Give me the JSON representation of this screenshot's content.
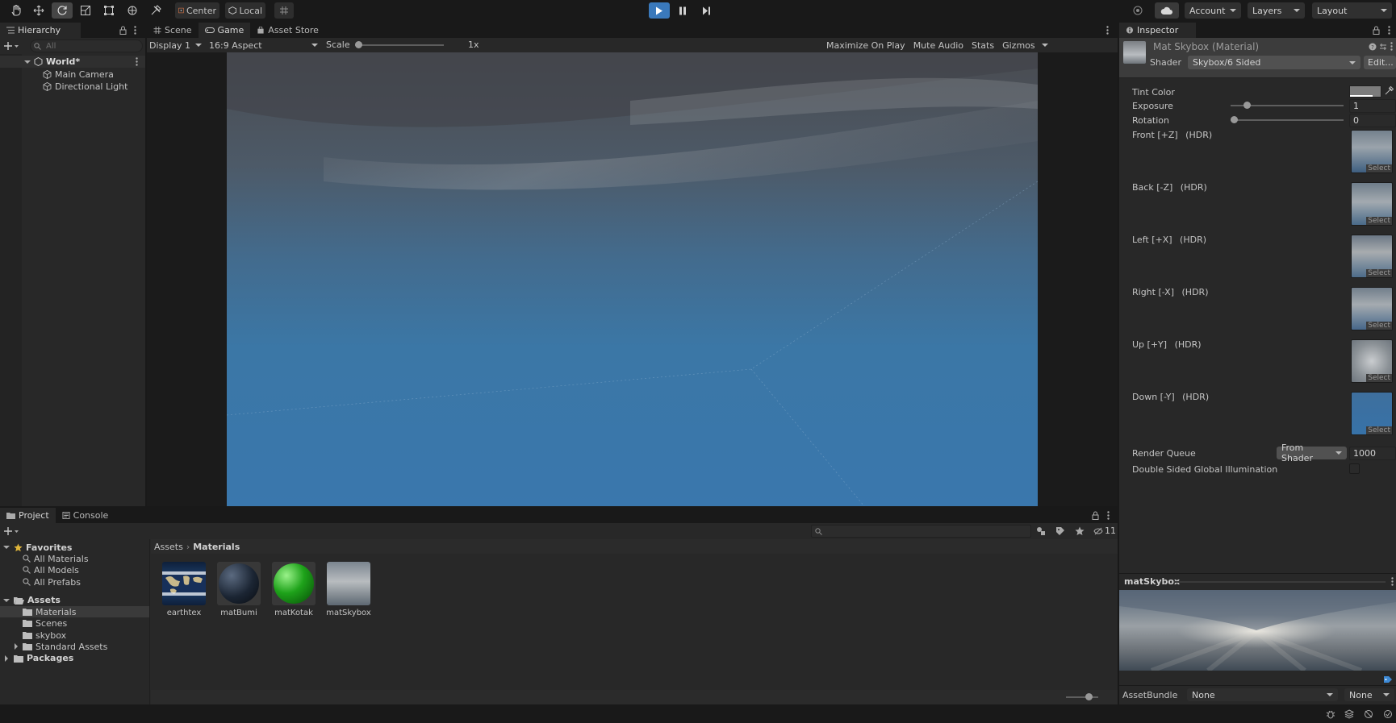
{
  "toolbar": {
    "pivot_label": "Center",
    "space_label": "Local",
    "account_label": "Account",
    "layers_label": "Layers",
    "layout_label": "Layout"
  },
  "hierarchy": {
    "tab_label": "Hierarchy",
    "search_placeholder": "All",
    "items": [
      {
        "label": "World*"
      },
      {
        "label": "Main Camera"
      },
      {
        "label": "Directional Light"
      }
    ]
  },
  "scene_view": {
    "tabs": [
      {
        "label": "Scene"
      },
      {
        "label": "Game"
      },
      {
        "label": "Asset Store"
      }
    ],
    "display_label": "Display 1",
    "aspect_label": "16:9 Aspect",
    "scale_label": "Scale",
    "scale_value": "1x",
    "scale_slider_fraction": 0.0,
    "maximize_label": "Maximize On Play",
    "mute_label": "Mute Audio",
    "stats_label": "Stats",
    "gizmos_label": "Gizmos"
  },
  "inspector": {
    "tab_label": "Inspector",
    "title": "Mat Skybox (Material)",
    "shader_label": "Shader",
    "shader_value": "Skybox/6 Sided",
    "edit_label": "Edit...",
    "tint_label": "Tint Color",
    "exposure_label": "Exposure",
    "exposure_value": "1",
    "exposure_slider_fraction": 0.12,
    "rotation_label": "Rotation",
    "rotation_value": "0",
    "rotation_slider_fraction": 0.0,
    "textures": [
      {
        "name": "Front [+Z]",
        "hdr": "(HDR)",
        "select": "Select"
      },
      {
        "name": "Back [-Z]",
        "hdr": "(HDR)",
        "select": "Select"
      },
      {
        "name": "Left [+X]",
        "hdr": "(HDR)",
        "select": "Select"
      },
      {
        "name": "Right [-X]",
        "hdr": "(HDR)",
        "select": "Select"
      },
      {
        "name": "Up [+Y]",
        "hdr": "(HDR)",
        "select": "Select"
      },
      {
        "name": "Down [-Y]",
        "hdr": "(HDR)",
        "select": "Select"
      }
    ],
    "render_queue_label": "Render Queue",
    "render_queue_mode": "From Shader",
    "render_queue_value": "1000",
    "double_sided_label": "Double Sided Global Illumination",
    "preview_title": "matSkybox",
    "assetbundle_label": "AssetBundle",
    "assetbundle_value": "None",
    "assetbundle_variant": "None"
  },
  "project": {
    "tabs": [
      {
        "label": "Project"
      },
      {
        "label": "Console"
      }
    ],
    "hidden_count": "11",
    "favorites_label": "Favorites",
    "favorites": [
      {
        "label": "All Materials"
      },
      {
        "label": "All Models"
      },
      {
        "label": "All Prefabs"
      }
    ],
    "assets_label": "Assets",
    "folders": [
      {
        "label": "Materials"
      },
      {
        "label": "Scenes"
      },
      {
        "label": "skybox"
      },
      {
        "label": "Standard Assets"
      }
    ],
    "packages_label": "Packages",
    "breadcrumb": {
      "root": "Assets",
      "current": "Materials"
    },
    "assets": [
      {
        "label": "earthtex"
      },
      {
        "label": "matBumi"
      },
      {
        "label": "matKotak"
      },
      {
        "label": "matSkybox"
      }
    ]
  }
}
